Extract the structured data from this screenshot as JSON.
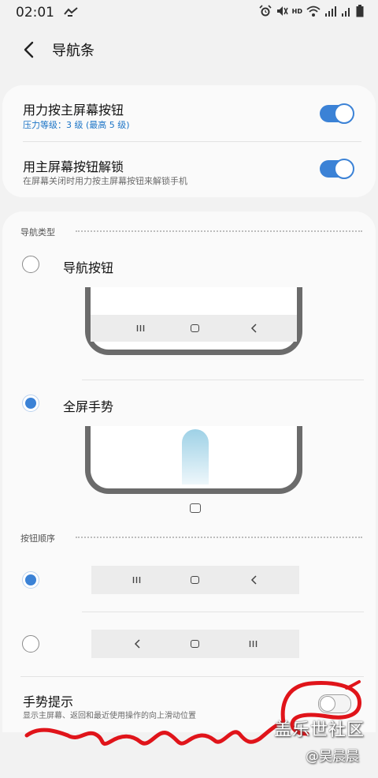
{
  "status_bar": {
    "time": "02:01",
    "hd_label": "HD",
    "icons": [
      "alarm-icon",
      "mute-icon",
      "wifi-icon",
      "signal-icon",
      "signal-icon",
      "battery-icon"
    ]
  },
  "header": {
    "title": "导航条"
  },
  "card_top": {
    "press_home": {
      "title": "用力按主屏幕按钮",
      "subtitle": "压力等级：3 级 (最高 5 级)"
    },
    "unlock_home": {
      "title": "用主屏幕按钮解锁",
      "subtitle": "在屏幕关闭时用力按主屏幕按钮来解锁手机"
    }
  },
  "nav_type": {
    "section_label": "导航类型",
    "option_buttons": "导航按钮",
    "option_gestures": "全屏手势",
    "selected": "全屏手势"
  },
  "button_order": {
    "section_label": "按钮顺序",
    "selected_index": 0
  },
  "gesture_hint": {
    "title": "手势提示",
    "subtitle": "显示主屏幕、返回和最近使用操作的向上滑动位置",
    "enabled": false
  },
  "watermark": {
    "line1": "盖乐世社区",
    "line2": "@吴晨晨"
  },
  "colors": {
    "accent": "#3b82d6",
    "scribble": "#e0141a"
  }
}
